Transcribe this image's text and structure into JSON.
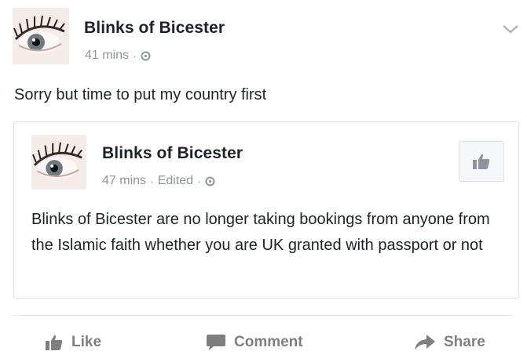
{
  "post": {
    "author": "Blinks of Bicester",
    "time": "41 mins",
    "dot": "·",
    "text": "Sorry but time to put my country first",
    "icons": {
      "avatar": "eyelash-eye-avatar",
      "privacy": "globe-icon",
      "menu": "chevron-down-icon"
    }
  },
  "shared_post": {
    "author": "Blinks of Bicester",
    "time": "47 mins",
    "sep": "·",
    "edited": "Edited",
    "dot": "·",
    "text": "Blinks of Bicester are no longer taking bookings from anyone from the Islamic faith whether you are UK granted with passport or not",
    "icons": {
      "like_page": "thumbs-up-icon"
    }
  },
  "actions": {
    "like": "Like",
    "comment": "Comment",
    "share": "Share"
  },
  "colors": {
    "text": "#1d2129",
    "meta": "#90949c",
    "action": "#7f7f7f",
    "border": "#dddfe2"
  }
}
